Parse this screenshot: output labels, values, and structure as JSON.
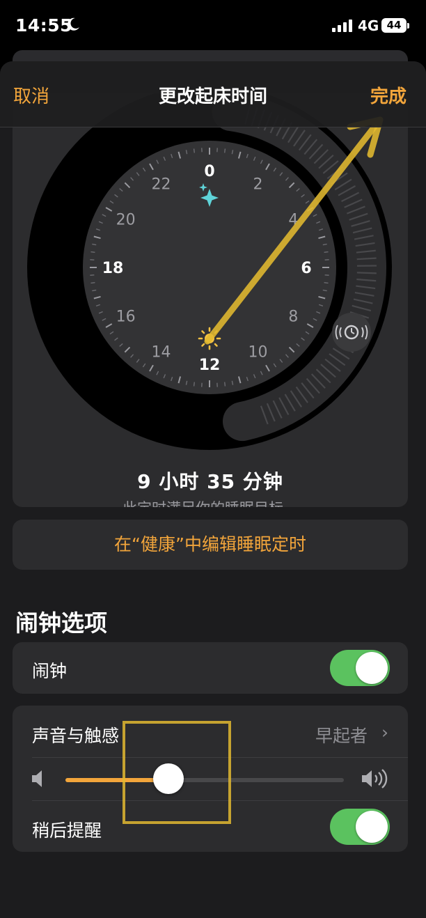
{
  "status_bar": {
    "time": "14:55",
    "network": "4G",
    "battery": "44"
  },
  "nav": {
    "cancel_label": "取消",
    "title": "更改起床时间",
    "done_label": "完成"
  },
  "clock": {
    "hour_labels": [
      "0",
      "2",
      "4",
      "6",
      "8",
      "10",
      "12",
      "14",
      "16",
      "18",
      "20",
      "22"
    ],
    "bedtime_icon": "sparkles-icon",
    "wakeup_icon": "sun-icon",
    "alarm_icon": "alarm-clock-icon"
  },
  "sleep": {
    "duration": "9 小时 35 分钟",
    "note": "此定时满足你的睡眠目标。"
  },
  "health_link": {
    "label": "在“健康”中编辑睡眠定时"
  },
  "alarm_section": {
    "title": "闹钟选项",
    "alarm": {
      "label": "闹钟",
      "enabled": true
    },
    "sound": {
      "label": "声音与触感",
      "value": "早起者"
    },
    "volume": {
      "level": 0.37
    },
    "snooze": {
      "label": "稍后提醒",
      "enabled": true
    }
  },
  "colors": {
    "accent": "#f2a53b",
    "toggle_on": "#5bc25f",
    "bedtime": "#5fd3d8",
    "wake": "#f5c242",
    "annotation": "#e2b930"
  }
}
